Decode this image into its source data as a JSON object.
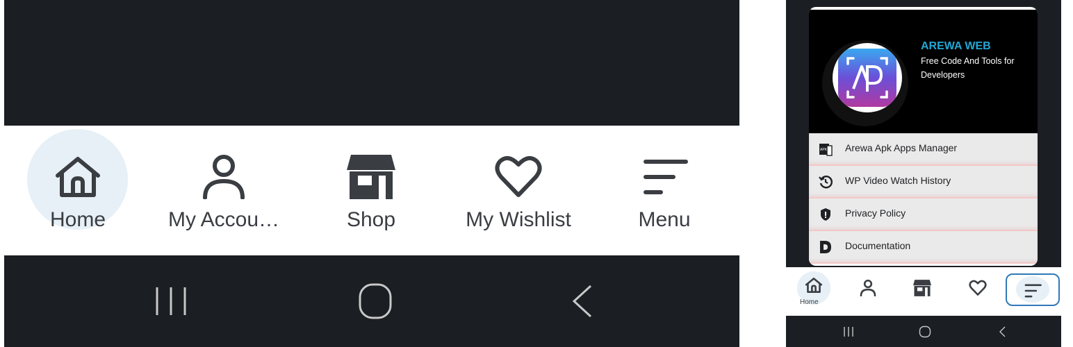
{
  "nav": {
    "items": [
      {
        "key": "home",
        "label": "Home",
        "icon": "home-icon"
      },
      {
        "key": "account",
        "label": "My Accou…",
        "icon": "user-icon"
      },
      {
        "key": "shop",
        "label": "Shop",
        "icon": "store-icon"
      },
      {
        "key": "wishlist",
        "label": "My Wishlist",
        "icon": "heart-icon"
      },
      {
        "key": "menu",
        "label": "Menu",
        "icon": "menu-icon"
      }
    ],
    "active": "home"
  },
  "system_nav": {
    "buttons": [
      "recents-icon",
      "home-circle-icon",
      "back-icon"
    ]
  },
  "drawer": {
    "brand_title": "AREWA WEB",
    "brand_subtitle": "Free Code And Tools for Developers",
    "items": [
      {
        "label": "Arewa Apk Apps Manager",
        "icon": "apk-icon"
      },
      {
        "label": "WP Video Watch History",
        "icon": "history-icon"
      },
      {
        "label": "Privacy Policy",
        "icon": "shield-icon"
      },
      {
        "label": "Documentation",
        "icon": "document-d-icon"
      }
    ]
  },
  "mini_nav": {
    "home_label": "Home",
    "selected": "menu"
  },
  "colors": {
    "dark_bg": "#1b1e22",
    "accent": "#22a7d6",
    "highlight": "#e6f0f6",
    "selected_border": "#2f79b8",
    "icon": "#3a3d42"
  }
}
